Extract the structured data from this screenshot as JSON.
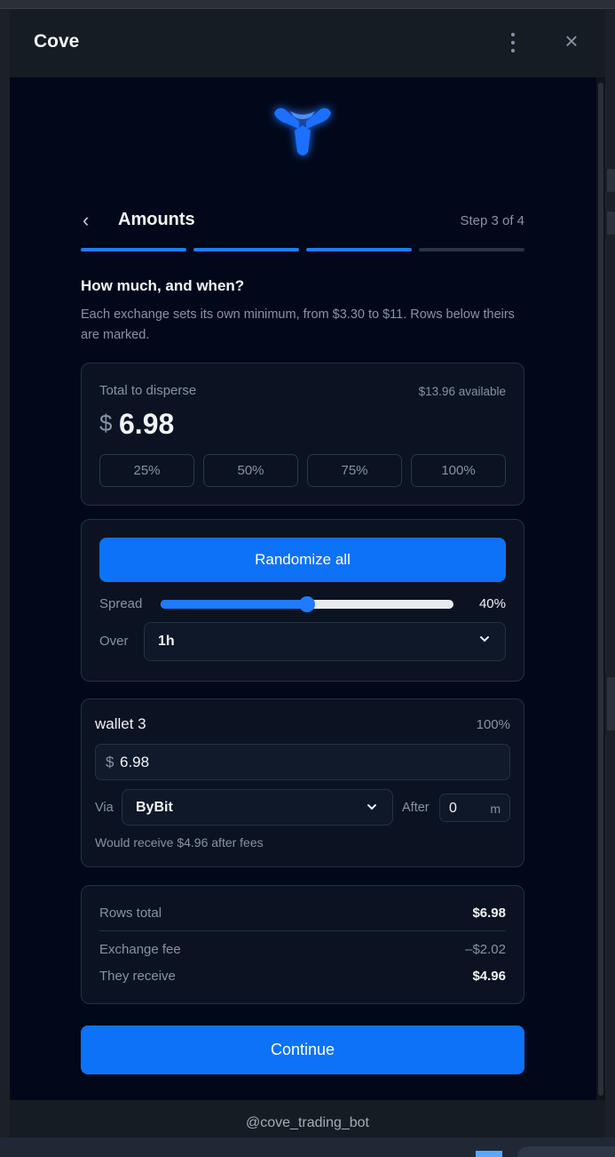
{
  "window": {
    "title": "Cove"
  },
  "header": {
    "back_label": "‹",
    "title": "Amounts",
    "step": "Step 3 of 4"
  },
  "progress": {
    "total_steps": 4,
    "current_step": 3
  },
  "question": {
    "title": "How much, and when?",
    "description": "Each exchange sets its own minimum, from $3.30 to $11. Rows below theirs are marked."
  },
  "total": {
    "label": "Total to disperse",
    "available": "$13.96 available",
    "currency": "$",
    "amount": "6.98",
    "presets": [
      "25%",
      "50%",
      "75%",
      "100%"
    ]
  },
  "randomize": {
    "button_label": "Randomize all",
    "spread_label": "Spread",
    "spread_value": "40%",
    "spread_fraction": 0.5,
    "over_label": "Over",
    "over_value": "1h"
  },
  "wallet": {
    "name": "wallet 3",
    "percent": "100%",
    "currency": "$",
    "amount": "6.98",
    "via_label": "Via",
    "via_value": "ByBit",
    "after_label": "After",
    "after_value": "0",
    "after_unit": "m",
    "note": "Would receive $4.96 after fees"
  },
  "summary": {
    "rows_total_label": "Rows total",
    "rows_total_value": "$6.98",
    "fee_label": "Exchange fee",
    "fee_value": "–$2.02",
    "receive_label": "They receive",
    "receive_value": "$4.96"
  },
  "continue_label": "Continue",
  "footer_handle": "@cove_trading_bot",
  "colors": {
    "accent": "#0d72f7",
    "background": "#01081a",
    "card": "#0b1322"
  }
}
